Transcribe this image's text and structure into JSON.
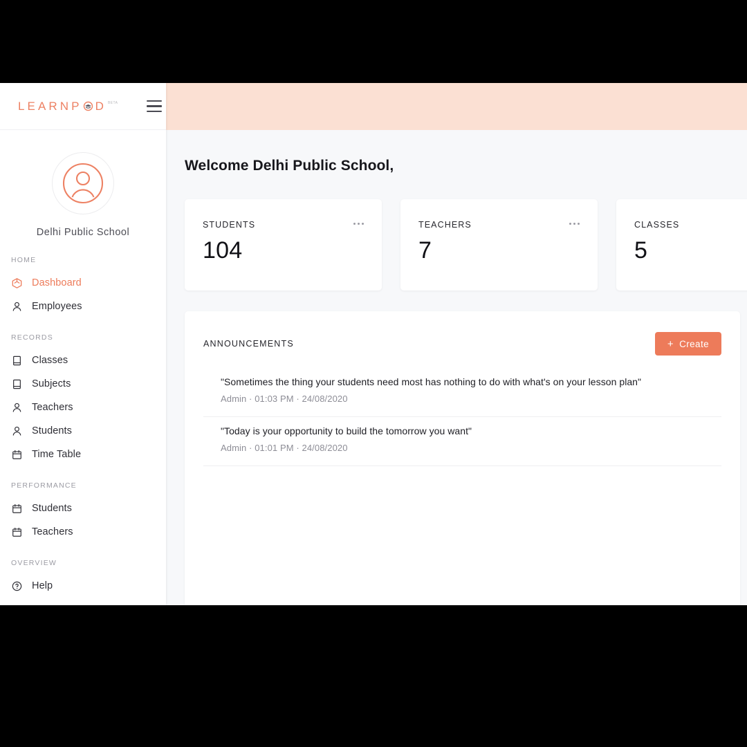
{
  "brand": {
    "name_part1": "LEARNP",
    "name_part2": "D",
    "beta": "BETA",
    "menu_icon": "hamburger-icon"
  },
  "profile": {
    "name": "Delhi Public School",
    "avatar_icon": "user-avatar-icon"
  },
  "sidebar": {
    "groups": [
      {
        "title": "HOME",
        "items": [
          {
            "label": "Dashboard",
            "icon": "cube-icon",
            "active": true
          },
          {
            "label": "Employees",
            "icon": "person-icon",
            "active": false
          }
        ]
      },
      {
        "title": "RECORDS",
        "items": [
          {
            "label": "Classes",
            "icon": "book-icon",
            "active": false
          },
          {
            "label": "Subjects",
            "icon": "book-icon",
            "active": false
          },
          {
            "label": "Teachers",
            "icon": "person-icon",
            "active": false
          },
          {
            "label": "Students",
            "icon": "person-icon",
            "active": false
          },
          {
            "label": "Time Table",
            "icon": "calendar-icon",
            "active": false
          }
        ]
      },
      {
        "title": "PERFORMANCE",
        "items": [
          {
            "label": "Students",
            "icon": "calendar-icon",
            "active": false
          },
          {
            "label": "Teachers",
            "icon": "calendar-icon",
            "active": false
          }
        ]
      },
      {
        "title": "OVERVIEW",
        "items": [
          {
            "label": "Help",
            "icon": "question-circle-icon",
            "active": false
          }
        ]
      }
    ]
  },
  "main": {
    "welcome": "Welcome Delhi Public School,",
    "stats": [
      {
        "label": "STUDENTS",
        "value": "104",
        "menu_icon": "more-options-icon"
      },
      {
        "label": "TEACHERS",
        "value": "7",
        "menu_icon": "more-options-icon"
      },
      {
        "label": "CLASSES",
        "value": "5",
        "menu_icon": "more-options-icon"
      }
    ],
    "announcements": {
      "title": "ANNOUNCEMENTS",
      "create_label": "Create",
      "create_icon": "plus-icon",
      "items": [
        {
          "text": "\"Sometimes the thing your students need most has nothing to do with what's on your lesson plan\"",
          "meta": "Admin · 01:03 PM · 24/08/2020"
        },
        {
          "text": "\"Today is your opportunity to build the tomorrow you want\"",
          "meta": "Admin · 01:01 PM · 24/08/2020"
        }
      ]
    }
  },
  "colors": {
    "accent": "#ED7B5A",
    "header_band": "#FBE0D3",
    "logo": "#ED8163",
    "page_bg": "#f7f8fa"
  }
}
